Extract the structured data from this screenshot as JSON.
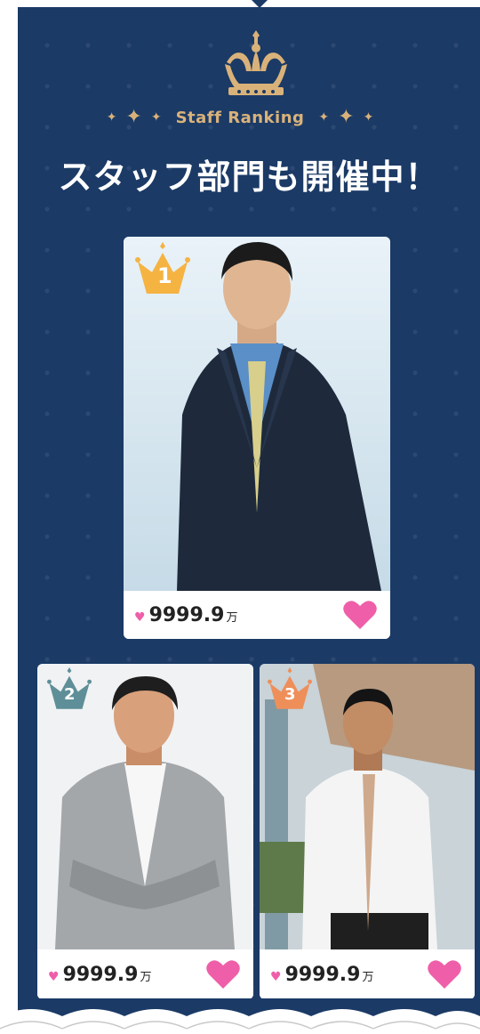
{
  "header": {
    "subtitle": "Staff Ranking",
    "headline": "スタッフ部門も開催中！"
  },
  "colors": {
    "panel": "#1b3a66",
    "gold": "#d9b27a",
    "heart": "#ef5ea8",
    "rank1": "#f5b342",
    "rank2": "#5e8f98",
    "rank3": "#ee8f5a"
  },
  "ranking": [
    {
      "rank": "1",
      "likes": "9999.9",
      "unit": "万"
    },
    {
      "rank": "2",
      "likes": "9999.9",
      "unit": "万"
    },
    {
      "rank": "3",
      "likes": "9999.9",
      "unit": "万"
    }
  ],
  "icons": {
    "crown": "crown-icon",
    "heart": "heart-icon",
    "sparkle": "sparkle-icon"
  }
}
